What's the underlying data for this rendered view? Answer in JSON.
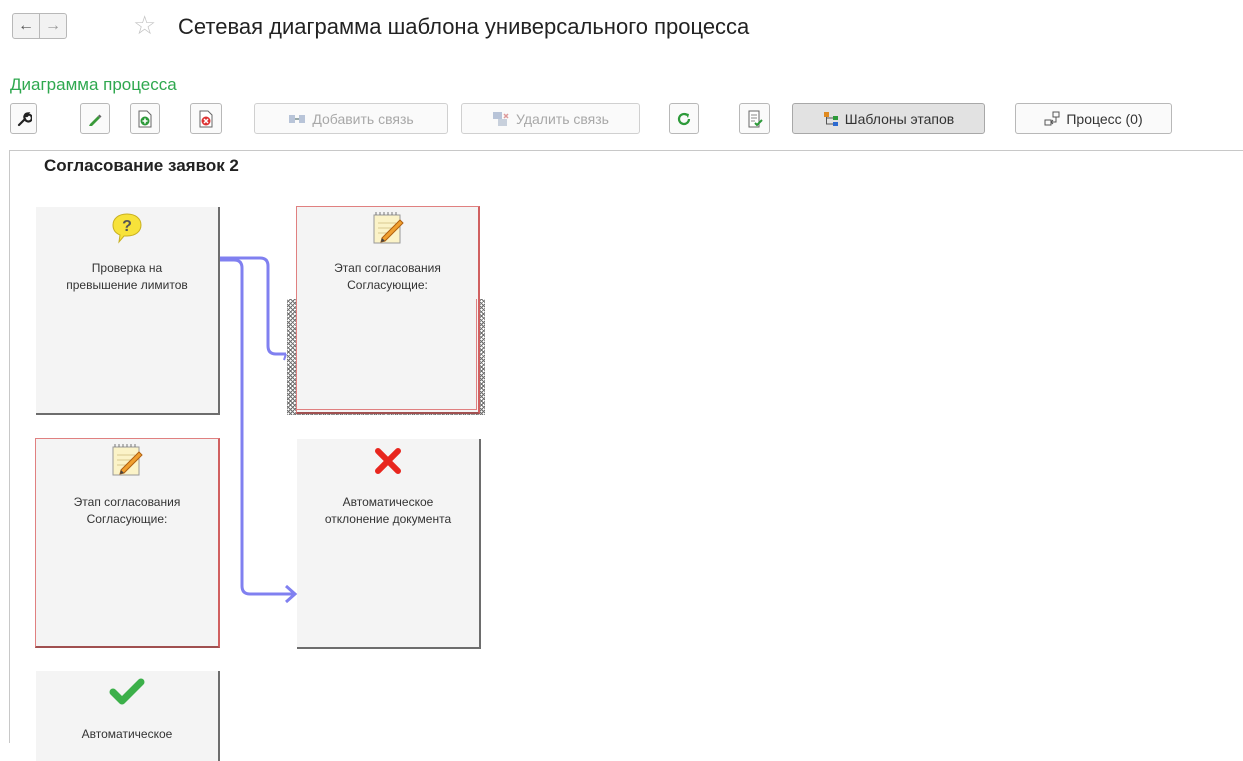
{
  "header": {
    "title": "Сетевая диаграмма шаблона универсального процесса",
    "back_glyph": "←",
    "forward_glyph": "→",
    "star_glyph": "☆"
  },
  "section": {
    "title": "Диаграмма процесса"
  },
  "toolbar": {
    "add_link": "Добавить связь",
    "delete_link": "Удалить связь",
    "stage_templates": "Шаблоны этапов",
    "process": "Процесс (0)"
  },
  "diagram": {
    "process_title": "Согласование заявок 2",
    "nodes": [
      {
        "id": "limit-check",
        "icon": "question-icon",
        "line1": "Проверка на",
        "line2": "превышение лимитов"
      },
      {
        "id": "approval-stage-1",
        "icon": "notepad-pencil-icon",
        "line1": "Этап согласования",
        "line2": "Согласующие:"
      },
      {
        "id": "approval-stage-2",
        "icon": "notepad-pencil-icon",
        "line1": "Этап согласования",
        "line2": "Согласующие:"
      },
      {
        "id": "auto-reject",
        "icon": "red-cross-icon",
        "line1": "Автоматическое",
        "line2": "отклонение документа"
      },
      {
        "id": "auto-approve",
        "icon": "green-check-icon",
        "line1": "Автоматическое",
        "line2": ""
      }
    ],
    "colors": {
      "link": "#8080f0",
      "stage_border": "#e08080",
      "green": "#2fa84f"
    }
  }
}
